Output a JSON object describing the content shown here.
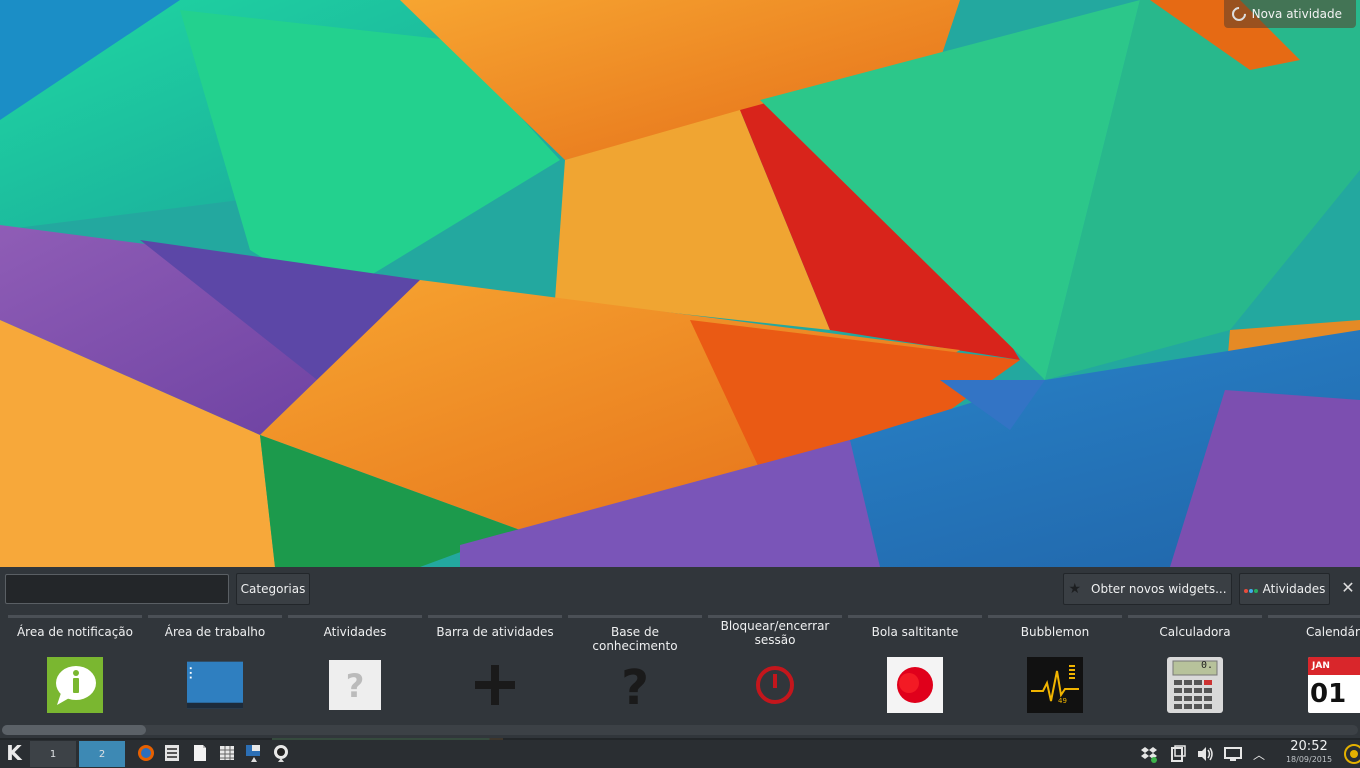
{
  "desktop": {
    "new_activity_label": "Nova atividade"
  },
  "explorer": {
    "search_value": "",
    "categories_label": "Categorias",
    "get_widgets_label": "Obter novos widgets...",
    "activities_label": "Atividades",
    "close_glyph": "✕",
    "widgets": [
      {
        "name": "Área de notificação",
        "icon": "notification-icon"
      },
      {
        "name": "Área de trabalho",
        "icon": "desktop-icon"
      },
      {
        "name": "Atividades",
        "icon": "activities-icon"
      },
      {
        "name": "Barra de atividades",
        "icon": "plus-icon"
      },
      {
        "name": "Base de conhecimento",
        "icon": "question-icon"
      },
      {
        "name": "Bloquear/encerrar sessão",
        "icon": "power-icon"
      },
      {
        "name": "Bola saltitante",
        "icon": "ball-icon"
      },
      {
        "name": "Bubblemon",
        "icon": "heartbeat-icon"
      },
      {
        "name": "Calculadora",
        "icon": "calculator-icon"
      },
      {
        "name": "Calendário",
        "icon": "calendar-icon",
        "calendar_month": "JAN",
        "calendar_day": "01"
      }
    ],
    "bubblemon_value": "49",
    "calculator_display": "0.",
    "scroll_position": 0.0
  },
  "taskbar": {
    "kicker_glyph": "K",
    "desktops": [
      "1",
      "2"
    ],
    "active_desktop": "2",
    "clock_time": "20:52",
    "clock_date": "18/09/2015"
  },
  "colors": {
    "panel_bg": "#31363b",
    "taskbar_bg": "#2a2e32",
    "active_desktop": "#3d89b4",
    "notification_green": "#7ab730",
    "power_red": "#c4161c"
  }
}
